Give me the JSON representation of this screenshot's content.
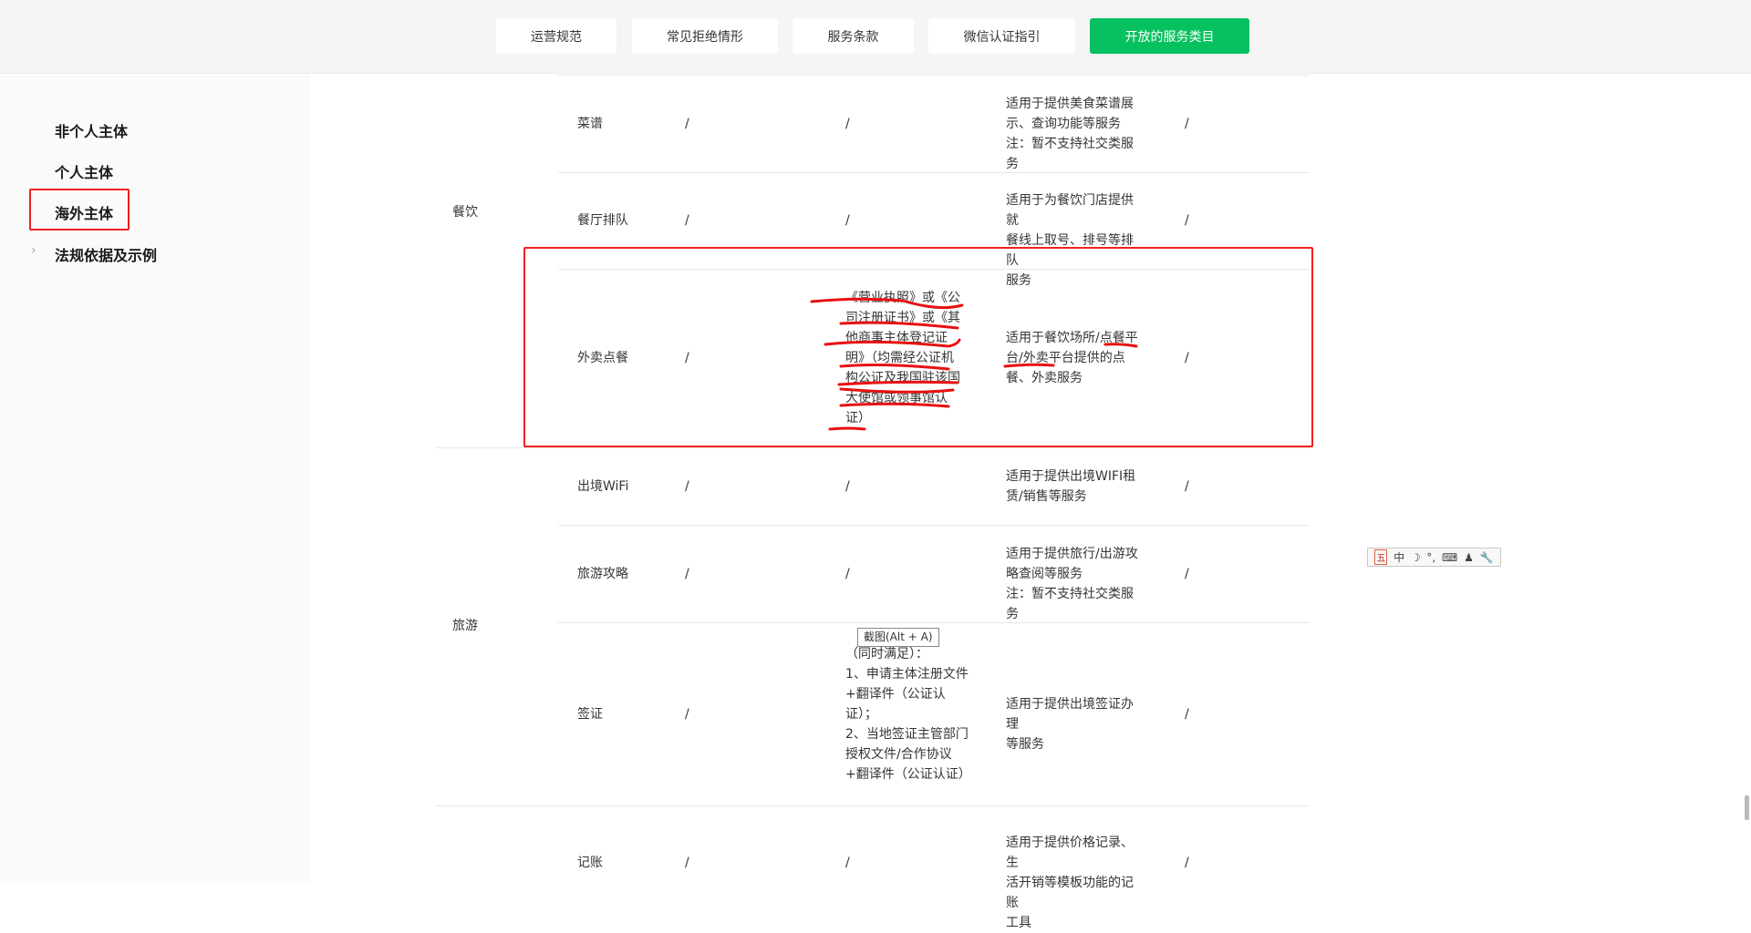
{
  "header": {
    "tabs": [
      {
        "label": "运营规范",
        "active": false
      },
      {
        "label": "常见拒绝情形",
        "active": false
      },
      {
        "label": "服务条款",
        "active": false
      },
      {
        "label": "微信认证指引",
        "active": false
      },
      {
        "label": "开放的服务类目",
        "active": true
      }
    ],
    "accent": "#07c160"
  },
  "sidebar": {
    "items": [
      {
        "label": "非个人主体"
      },
      {
        "label": "个人主体"
      },
      {
        "label": "海外主体"
      },
      {
        "label": "法规依据及示例"
      }
    ]
  },
  "table": {
    "categories": [
      {
        "label": "餐饮"
      },
      {
        "label": "旅游"
      }
    ],
    "rows": [
      {
        "name": "菜谱",
        "c2": "/",
        "c3": "/",
        "c4": [
          "适用于提供美食菜谱展",
          "示、查询功能等服务",
          "注：暂不支持社交类服务"
        ],
        "c5": "/"
      },
      {
        "name": "餐厅排队",
        "c2": "/",
        "c3": "/",
        "c4": [
          "适用于为餐饮门店提供就",
          "餐线上取号、排号等排队",
          "服务"
        ],
        "c5": "/"
      },
      {
        "name": "外卖点餐",
        "c2": "/",
        "c3": [
          "《营业执照》或《公",
          "司注册证书》或《其",
          "他商事主体登记证",
          "明》（均需经公证机",
          "构公证及我国驻该国",
          "大使馆或领事馆认",
          "证）"
        ],
        "c4": [
          "适用于餐饮场所/点餐平",
          "台/外卖平台提供的点",
          "餐、外卖服务"
        ],
        "c5": "/"
      },
      {
        "name": "出境WiFi",
        "c2": "/",
        "c3": "/",
        "c4": [
          "适用于提供出境WIFI租",
          "赁/销售等服务"
        ],
        "c5": "/"
      },
      {
        "name": "旅游攻略",
        "c2": "/",
        "c3": "/",
        "c4": [
          "适用于提供旅行/出游攻",
          "略查阅等服务",
          "注：暂不支持社交类服务"
        ],
        "c5": "/"
      },
      {
        "name": "签证",
        "c2": "/",
        "c3": [
          "（同时满足）：",
          "1、申请主体注册文件",
          "+翻译件（公证认",
          "证）；",
          "2、当地签证主管部门",
          "授权文件/合作协议",
          "+翻译件（公证认证）"
        ],
        "c4": [
          "适用于提供出境签证办理",
          "等服务"
        ],
        "c5": "/"
      },
      {
        "name": "记账",
        "c2": "/",
        "c3": "/",
        "c4": [
          "适用于提供价格记录、生",
          "活开销等模板功能的记账",
          "工具"
        ],
        "c5": "/"
      }
    ]
  },
  "tooltip": "截图(Alt + A)",
  "ime": {
    "items": [
      "五",
      "中",
      "☽",
      "°,",
      "⌨",
      "♟",
      "🔧"
    ]
  }
}
